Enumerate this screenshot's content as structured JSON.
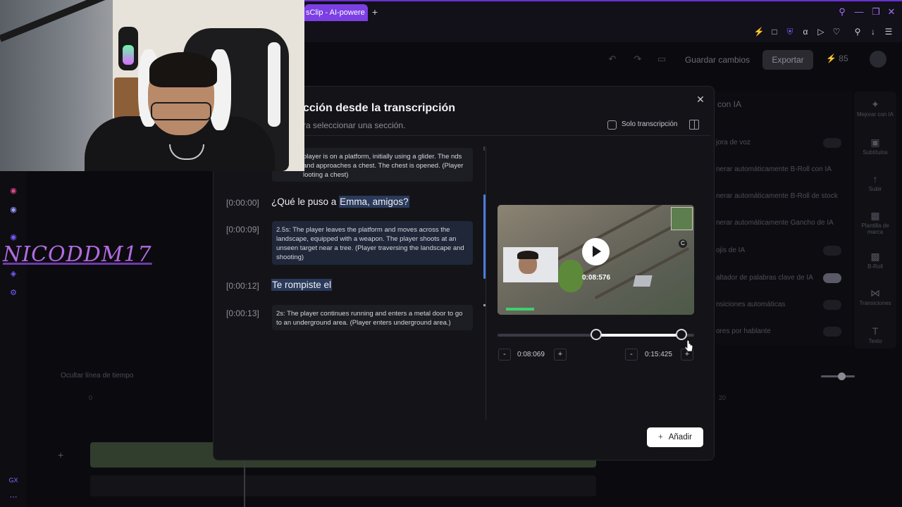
{
  "browser": {
    "active_tab_title": "sClip - AI-powere",
    "new_tab": "+",
    "window_controls": [
      "minimize",
      "maximize",
      "close"
    ]
  },
  "editor": {
    "save_label": "Guardar cambios",
    "export_label": "Exportar",
    "credits": "85",
    "streamer_name": "NICODDM17",
    "timeline_label": "Ocultar línea de tiempo",
    "timeline_start_tick": "0",
    "timeline_end_tick": "20"
  },
  "right_panel": {
    "title": "con IA",
    "rows": [
      "jora de voz",
      "nerar automáticamente B-Roll con IA",
      "nerar automáticamente B-Roll de stock",
      "nerar automáticamente Gancho de IA",
      "ojis de IA",
      "altador de palabras clave de IA",
      "nsiciones automáticas",
      "ores por hablante"
    ],
    "rail": [
      "Mejorar con IA",
      "Subtítulos",
      "Subir",
      "Plantilla de marca",
      "B-Roll",
      "Transiciones",
      "Texto"
    ]
  },
  "modal": {
    "title": "cción desde la transcripción",
    "subtitle": "ra seleccionar una sección.",
    "solo_label": "Solo transcripción",
    "add_label": "Añadir",
    "add_plus": "+"
  },
  "transcript": [
    {
      "kind": "desc",
      "text": "player is on a platform, initially using a glider. The nds and approaches a chest. The chest is opened. (Player looting a chest)"
    },
    {
      "kind": "speech",
      "time": "[0:00:00]",
      "before": "¿Qué le puso a ",
      "highlight": "Emma, amigos?"
    },
    {
      "kind": "desc",
      "time": "[0:00:09]",
      "text": "2.5s: The player leaves the platform and moves across the landscape, equipped with a weapon. The player shoots at an unseen target near a tree. (Player traversing the landscape and shooting)"
    },
    {
      "kind": "speech",
      "time": "[0:00:12]",
      "before": "",
      "highlight": "Te rompiste el"
    },
    {
      "kind": "desc",
      "time": "[0:00:13]",
      "text": "2s: The player continues running and enters a metal door to go to an underground area. (Player enters underground area.)"
    }
  ],
  "preview": {
    "time": "0:08:576",
    "start": "0:08:069",
    "end": "0:15:425",
    "minus": "-",
    "plus": "+"
  }
}
